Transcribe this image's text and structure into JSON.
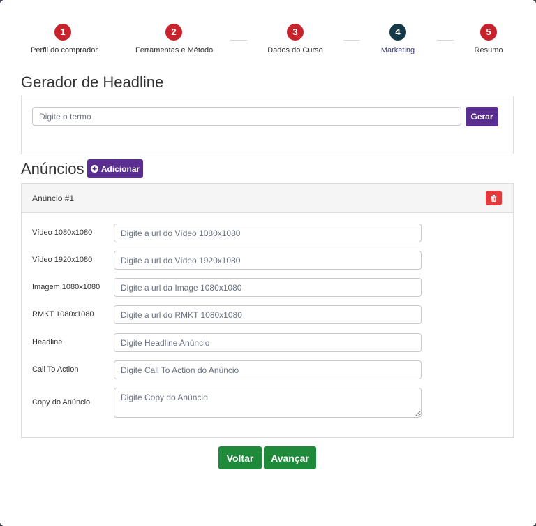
{
  "stepper": {
    "steps": [
      {
        "number": "1",
        "label": "Perfil do comprador"
      },
      {
        "number": "2",
        "label": "Ferramentas e Método"
      },
      {
        "number": "3",
        "label": "Dados do Curso"
      },
      {
        "number": "4",
        "label": "Marketing"
      },
      {
        "number": "5",
        "label": "Resumo"
      }
    ],
    "active_step": 4
  },
  "headline": {
    "title": "Gerador de Headline",
    "input_placeholder": "Digite o termo",
    "generate_label": "Gerar"
  },
  "ads": {
    "title": "Anúncios",
    "add_label": "Adicionar",
    "ad": {
      "title": "Anúncio #1",
      "fields": [
        {
          "label": "Vídeo 1080x1080",
          "placeholder": "Digite a url do Vídeo 1080x1080"
        },
        {
          "label": "Vídeo 1920x1080",
          "placeholder": "Digite a url do Vídeo 1920x1080"
        },
        {
          "label": "Imagem 1080x1080",
          "placeholder": "Digite a url da Image 1080x1080"
        },
        {
          "label": "RMKT 1080x1080",
          "placeholder": "Digite a url do RMKT 1080x1080"
        },
        {
          "label": "Headline",
          "placeholder": "Digite Headline Anúncio"
        },
        {
          "label": "Call To Action",
          "placeholder": "Digite Call To Action do Anúncio"
        },
        {
          "label": "Copy do Anúncio",
          "placeholder": "Digite Copy do Anúncio"
        }
      ]
    }
  },
  "nav": {
    "back_label": "Voltar",
    "next_label": "Avançar"
  },
  "colors": {
    "step_default": "#c8232c",
    "step_active": "#16394a",
    "primary_purple": "#5a2d91",
    "success_green": "#1f8a3a",
    "danger_red": "#e5393b"
  }
}
